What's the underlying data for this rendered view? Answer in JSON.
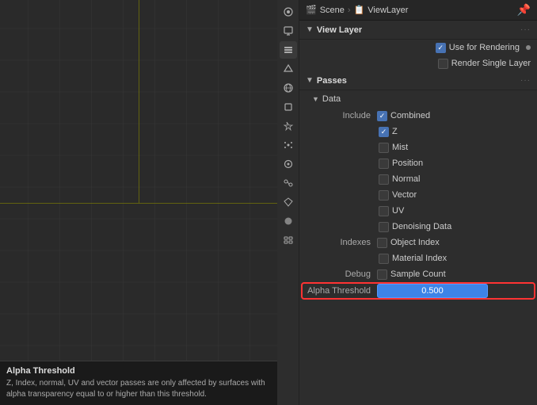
{
  "header": {
    "breadcrumb": {
      "icon1": "🎬",
      "label1": "Scene",
      "separator": "›",
      "icon2": "📋",
      "label2": "ViewLayer"
    },
    "pin_label": "📌"
  },
  "view_layer_section": {
    "title": "View Layer",
    "use_for_rendering": {
      "label": "Use for Rendering",
      "checked": true
    },
    "render_single_layer": {
      "label": "Render Single Layer",
      "checked": false
    }
  },
  "passes_section": {
    "title": "Passes",
    "data_subsection": {
      "title": "Data",
      "include_label": "Include",
      "items": [
        {
          "label": "Combined",
          "checked": true
        },
        {
          "label": "Z",
          "checked": true
        },
        {
          "label": "Mist",
          "checked": false
        },
        {
          "label": "Position",
          "checked": false
        },
        {
          "label": "Normal",
          "checked": false
        },
        {
          "label": "Vector",
          "checked": false
        },
        {
          "label": "UV",
          "checked": false
        },
        {
          "label": "Denoising Data",
          "checked": false
        }
      ],
      "indexes_label": "Indexes",
      "indexes_items": [
        {
          "label": "Object Index",
          "checked": false
        },
        {
          "label": "Material Index",
          "checked": false
        }
      ],
      "debug_label": "Debug",
      "debug_items": [
        {
          "label": "Sample Count",
          "checked": false
        }
      ],
      "alpha_threshold_label": "Alpha Threshold",
      "alpha_threshold_value": "0.500"
    }
  },
  "tooltip": {
    "title": "Alpha Threshold",
    "text": "Z, Index, normal, UV and vector passes are only affected by surfaces with alpha transparency equal to or higher than\nthis threshold."
  },
  "sidebar": {
    "icons": [
      {
        "name": "render-icon",
        "symbol": "📷"
      },
      {
        "name": "output-icon",
        "symbol": "🖥"
      },
      {
        "name": "view-layer-icon",
        "symbol": "📋"
      },
      {
        "name": "scene-icon",
        "symbol": "🎬"
      },
      {
        "name": "world-icon",
        "symbol": "🌐"
      },
      {
        "name": "object-icon",
        "symbol": "⬛"
      },
      {
        "name": "modifier-icon",
        "symbol": "🔧"
      },
      {
        "name": "particles-icon",
        "symbol": "✳"
      },
      {
        "name": "physics-icon",
        "symbol": "⊙"
      },
      {
        "name": "constraints-icon",
        "symbol": "🔗"
      },
      {
        "name": "data-icon",
        "symbol": "▲"
      },
      {
        "name": "material-icon",
        "symbol": "⬤"
      }
    ]
  }
}
